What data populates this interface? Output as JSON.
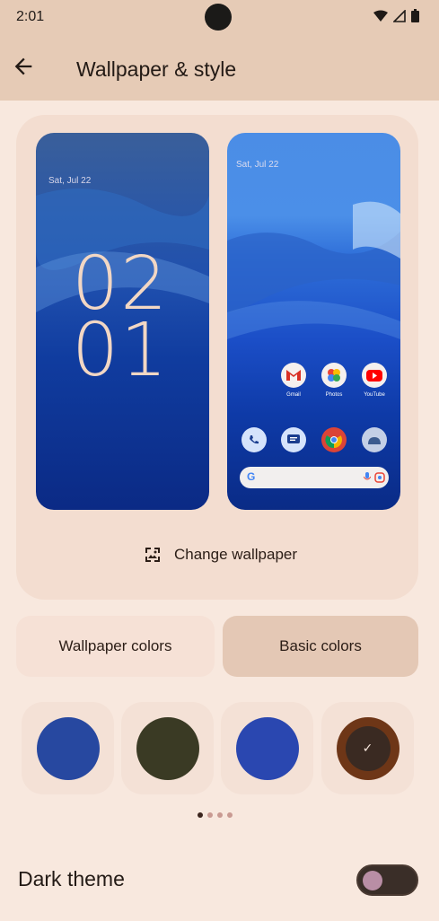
{
  "status": {
    "time": "2:01"
  },
  "header": {
    "title": "Wallpaper & style"
  },
  "lock_preview": {
    "date": "Sat, Jul 22",
    "hour": "02",
    "minute": "01"
  },
  "home_preview": {
    "date": "Sat, Jul 22",
    "apps_row1": [
      {
        "label": "Gmail",
        "icon": "gmail-icon"
      },
      {
        "label": "Photos",
        "icon": "photos-icon"
      },
      {
        "label": "YouTube",
        "icon": "youtube-icon"
      }
    ],
    "dock": [
      "phone-icon",
      "messages-icon",
      "chrome-icon",
      "android-icon"
    ]
  },
  "change_wallpaper_label": "Change wallpaper",
  "tabs": {
    "wallpaper_colors": "Wallpaper colors",
    "basic_colors": "Basic colors",
    "selected": "Basic colors"
  },
  "swatches": [
    {
      "color": "#2748a0",
      "selected": false
    },
    {
      "color": "#3a3a24",
      "selected": false
    },
    {
      "color": "#2a47b0",
      "selected": false
    },
    {
      "color": "#6e3617",
      "selected": true
    }
  ],
  "pager": {
    "pages": 4,
    "current": 1
  },
  "dark_theme": {
    "label": "Dark theme",
    "enabled": false
  }
}
